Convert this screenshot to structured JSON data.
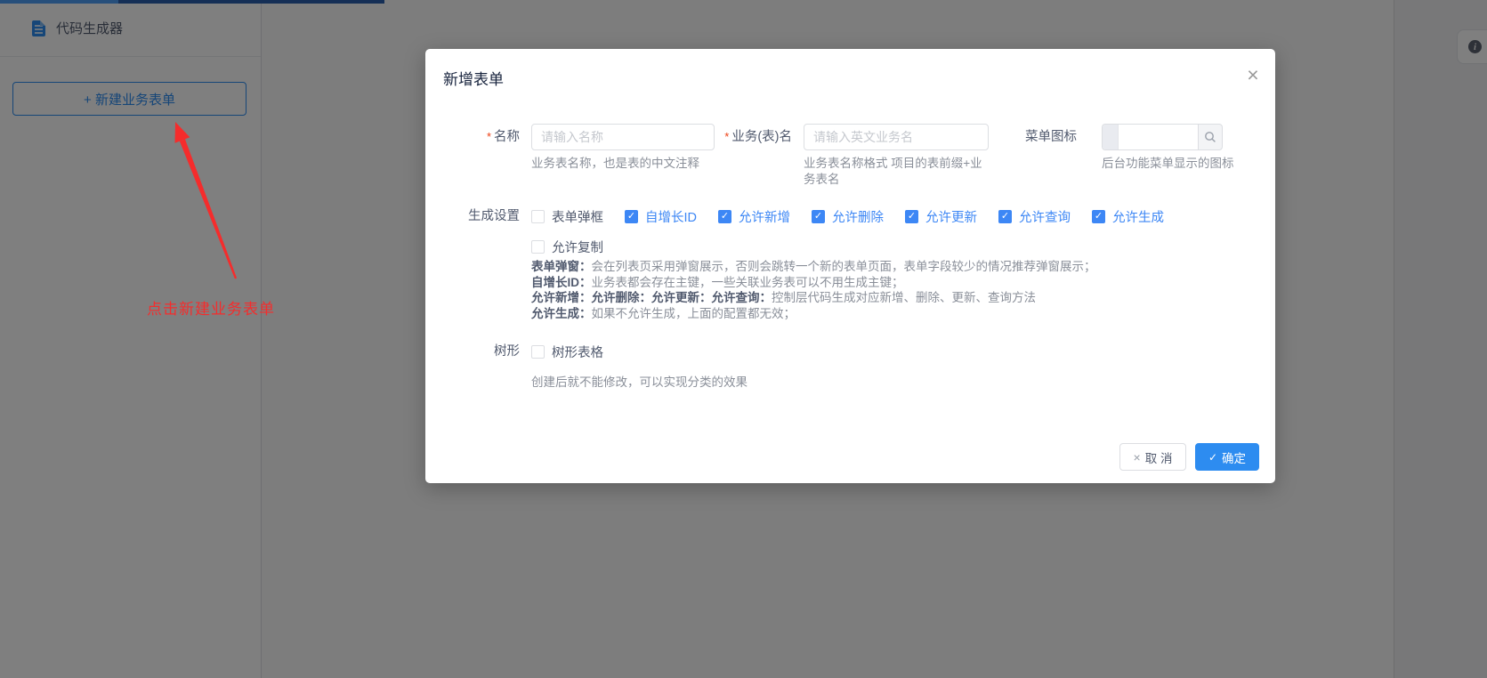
{
  "sidebar": {
    "menu_item_label": "代码生成器",
    "new_form_button_label": "+ 新建业务表单"
  },
  "annotation": {
    "note_text": "点击新建业务表单",
    "arrow_color": "#f52c2c"
  },
  "right_panel": {
    "info_icon": "i"
  },
  "modal": {
    "title": "新增表单",
    "close_icon": "×",
    "fields": [
      {
        "label": "名称",
        "required": "*",
        "placeholder": "请输入名称",
        "helper": "业务表名称，也是表的中文注释"
      },
      {
        "label": "业务(表)名",
        "required": "*",
        "placeholder": "请输入英文业务名",
        "helper": "业务表名称格式 项目的表前缀+业务表名"
      },
      {
        "label": "菜单图标",
        "value": "",
        "helper": "后台功能菜单显示的图标",
        "append_icon": "search"
      }
    ],
    "generate_settings": {
      "label": "生成设置",
      "check_mark": "✓",
      "checkboxes": [
        {
          "label": "表单弹框",
          "checked": false
        },
        {
          "label": "自增长ID",
          "checked": true
        },
        {
          "label": "允许新增",
          "checked": true
        },
        {
          "label": "允许删除",
          "checked": true
        },
        {
          "label": "允许更新",
          "checked": true
        },
        {
          "label": "允许查询",
          "checked": true
        },
        {
          "label": "允许生成",
          "checked": true
        },
        {
          "label": "允许复制",
          "checked": false
        }
      ],
      "help_lines": [
        {
          "bold": "表单弹窗：",
          "text": "会在列表页采用弹窗展示，否则会跳转一个新的表单页面，表单字段较少的情况推荐弹窗展示；"
        },
        {
          "bold": "自增长ID：",
          "text": "业务表都会存在主键，一些关联业务表可以不用生成主键；"
        },
        {
          "bold": "允许新增：允许删除：允许更新：允许查询：",
          "text": "控制层代码生成对应新增、删除、更新、查询方法"
        },
        {
          "bold": "允许生成：",
          "text": "如果不允许生成，上面的配置都无效；"
        }
      ]
    },
    "tree": {
      "label": "树形",
      "checkbox_label": "树形表格",
      "checked": false,
      "helper": "创建后就不能修改，可以实现分类的效果"
    },
    "footer": {
      "cancel_icon": "×",
      "cancel_label": "取 消",
      "confirm_icon": "✓",
      "confirm_label": "确定"
    }
  },
  "colors": {
    "accent_blue": "#2d8cf0",
    "checked_blue": "#3d87f5",
    "annotation_red": "#f52c2c",
    "topbar_blue": "#4f9ef7",
    "topbar_navy": "#2b5fad"
  }
}
